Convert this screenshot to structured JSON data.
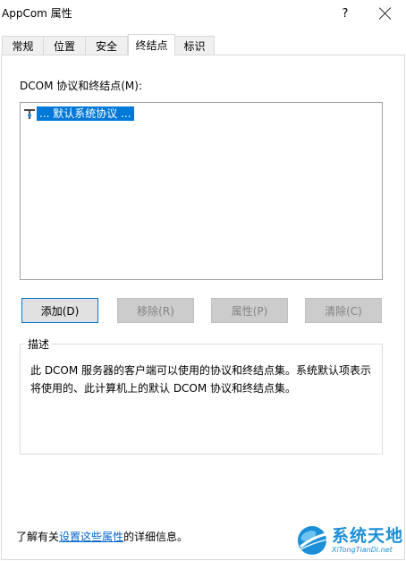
{
  "window": {
    "title": "AppCom 属性",
    "help_label": "?"
  },
  "tabs": [
    {
      "label": "常规",
      "active": false
    },
    {
      "label": "位置",
      "active": false
    },
    {
      "label": "安全",
      "active": false
    },
    {
      "label": "终结点",
      "active": true
    },
    {
      "label": "标识",
      "active": false
    }
  ],
  "endpoints": {
    "list_label": "DCOM 协议和终结点(M):",
    "items": [
      {
        "label": "... 默认系统协议 ...",
        "icon": "network-protocol-icon",
        "selected": true
      }
    ]
  },
  "buttons": {
    "add": "添加(D)",
    "remove": "移除(R)",
    "properties": "属性(P)",
    "clear": "清除(C)"
  },
  "description": {
    "legend": "描述",
    "text": "此 DCOM 服务器的客户端可以使用的协议和终结点集。系统默认项表示将使用的、此计算机上的默认 DCOM 协议和终结点集。"
  },
  "footer": {
    "prefix": "了解有关",
    "link": "设置这些属性",
    "suffix": "的详细信息。"
  },
  "watermark": {
    "main": "系统天地",
    "sub": "XiTongTianDi.net"
  },
  "colors": {
    "selection": "#0078d7",
    "link": "#0066cc",
    "watermark": "#1a8fd8"
  }
}
